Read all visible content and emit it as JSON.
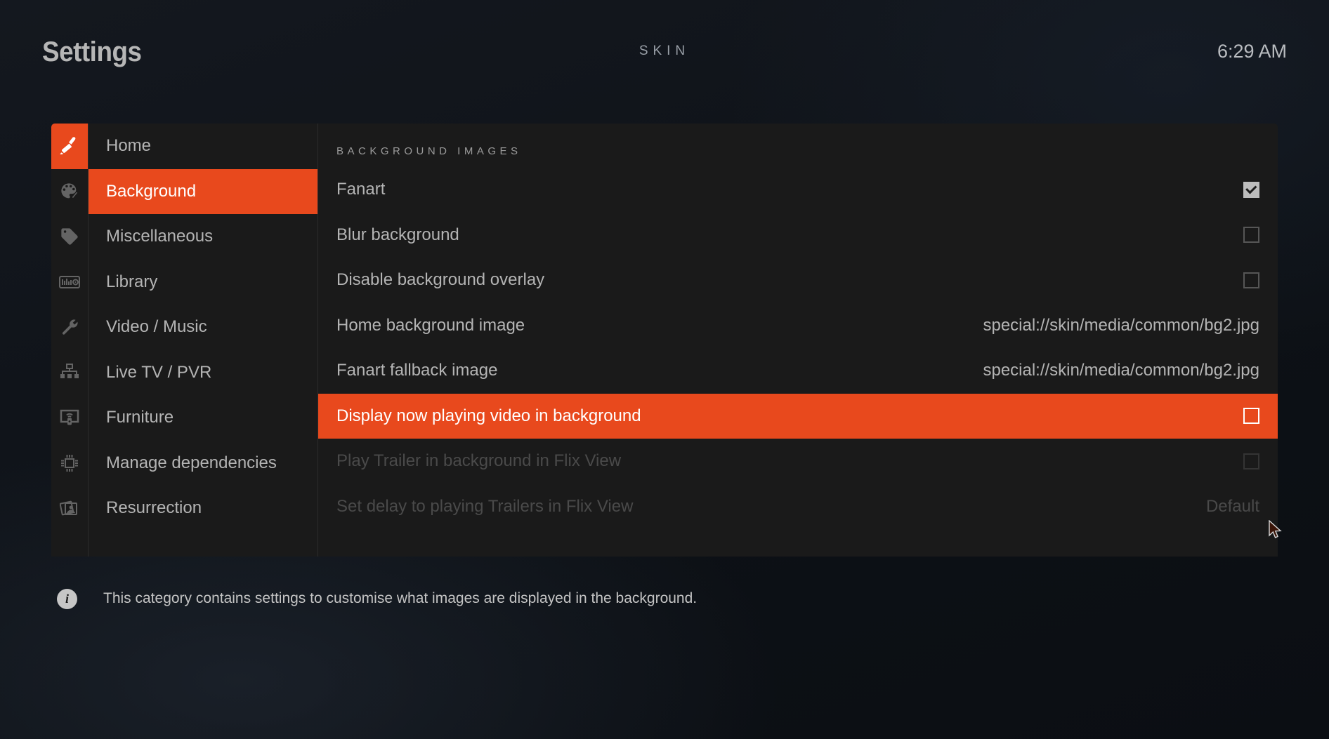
{
  "header": {
    "title": "Settings",
    "center_label": "SKIN",
    "clock": "6:29 AM"
  },
  "colors": {
    "accent": "#e8491d",
    "panel_bg": "#1a1a1a",
    "page_bg": "#10141a",
    "text": "#b4b4b4",
    "text_disabled": "#4a4a4a"
  },
  "rail": {
    "items": [
      {
        "icon": "paintbrush-icon",
        "active": true
      },
      {
        "icon": "palette-icon",
        "active": false
      },
      {
        "icon": "tag-icon",
        "active": false
      },
      {
        "icon": "media-library-icon",
        "active": false
      },
      {
        "icon": "wrench-icon",
        "active": false
      },
      {
        "icon": "network-icon",
        "active": false
      },
      {
        "icon": "tv-remote-icon",
        "active": false
      },
      {
        "icon": "cpu-chip-icon",
        "active": false
      },
      {
        "icon": "photos-icon",
        "active": false
      }
    ]
  },
  "nav": {
    "items": [
      {
        "label": "Home",
        "selected": false
      },
      {
        "label": "Background",
        "selected": true
      },
      {
        "label": "Miscellaneous",
        "selected": false
      },
      {
        "label": "Library",
        "selected": false
      },
      {
        "label": "Video / Music",
        "selected": false
      },
      {
        "label": "Live TV / PVR",
        "selected": false
      },
      {
        "label": "Furniture",
        "selected": false
      },
      {
        "label": "Manage dependencies",
        "selected": false
      },
      {
        "label": "Resurrection",
        "selected": false
      }
    ]
  },
  "content": {
    "group_title": "BACKGROUND IMAGES",
    "rows": [
      {
        "label": "Fanart",
        "control": "checkbox",
        "checked": true,
        "selected": false,
        "disabled": false,
        "value": ""
      },
      {
        "label": "Blur background",
        "control": "checkbox",
        "checked": false,
        "selected": false,
        "disabled": false,
        "value": ""
      },
      {
        "label": "Disable background overlay",
        "control": "checkbox",
        "checked": false,
        "selected": false,
        "disabled": false,
        "value": ""
      },
      {
        "label": "Home background image",
        "control": "value",
        "checked": false,
        "selected": false,
        "disabled": false,
        "value": "special://skin/media/common/bg2.jpg"
      },
      {
        "label": "Fanart fallback image",
        "control": "value",
        "checked": false,
        "selected": false,
        "disabled": false,
        "value": "special://skin/media/common/bg2.jpg"
      },
      {
        "label": "Display now playing video in background",
        "control": "checkbox",
        "checked": false,
        "selected": true,
        "disabled": false,
        "value": ""
      },
      {
        "label": "Play Trailer in background in Flix View",
        "control": "checkbox",
        "checked": false,
        "selected": false,
        "disabled": true,
        "value": ""
      },
      {
        "label": "Set delay to playing Trailers in Flix View",
        "control": "value",
        "checked": false,
        "selected": false,
        "disabled": true,
        "value": "Default"
      }
    ]
  },
  "footer": {
    "icon": "info-icon",
    "badge_char": "i",
    "description": "This category contains settings to customise what images are displayed in the background."
  }
}
